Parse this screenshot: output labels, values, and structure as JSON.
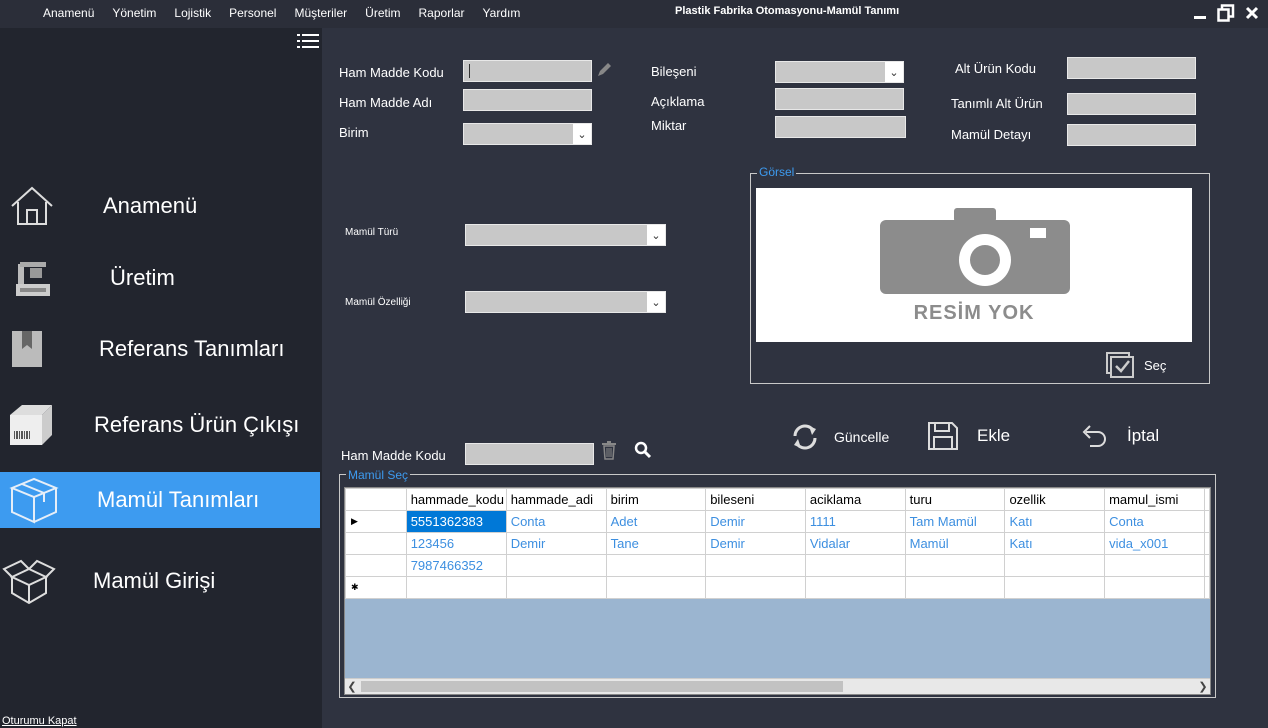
{
  "window": {
    "title": "Plastik Fabrika Otomasyonu-Mamül Tanımı",
    "menu": [
      "Anamenü",
      "Yönetim",
      "Lojistik",
      "Personel",
      "Müşteriler",
      "Üretim",
      "Raporlar",
      "Yardım"
    ]
  },
  "sidebar": {
    "items": [
      {
        "label": "Anamenü",
        "icon": "home-icon"
      },
      {
        "label": "Üretim",
        "icon": "machine-icon"
      },
      {
        "label": "Referans Tanımları",
        "icon": "bookmark-icon"
      },
      {
        "label": "Referans Ürün Çıkışı",
        "icon": "box-barcode-icon"
      },
      {
        "label": "Mamül Tanımları",
        "icon": "box-icon"
      },
      {
        "label": "Mamül Girişi",
        "icon": "open-box-icon"
      }
    ],
    "active_index": 4,
    "logout": "Oturumu Kapat"
  },
  "form": {
    "ham_madde_kodu": "Ham Madde Kodu",
    "ham_madde_adi": "Ham Madde Adı",
    "birim": "Birim",
    "bileseni": "Bileşeni",
    "aciklama": "Açıklama",
    "miktar": "Miktar",
    "alt_urun_kodu": "Alt Ürün Kodu",
    "tanimli_alt_urun": "Tanımlı Alt Ürün",
    "mamul_detayi": "Mamül Detayı",
    "mamul_turu": "Mamül Türü",
    "mamul_ozelligi": "Mamül Özelliği"
  },
  "gorsel": {
    "title": "Görsel",
    "no_image_text": "RESİM YOK",
    "select_label": "Seç"
  },
  "actions": {
    "guncelle": "Güncelle",
    "ekle": "Ekle",
    "iptal": "İptal"
  },
  "search": {
    "label": "Ham Madde Kodu"
  },
  "grid": {
    "title": "Mamül Seç",
    "columns": [
      "hammade_kodu",
      "hammade_adi",
      "birim",
      "bileseni",
      "aciklama",
      "turu",
      "ozellik",
      "mamul_ismi"
    ],
    "rows": [
      [
        "5551362383",
        "Conta",
        "Adet",
        "Demir",
        "1111",
        "Tam Mamül",
        "Katı",
        "Conta"
      ],
      [
        "123456",
        "Demir",
        "Tane",
        "Demir",
        "Vidalar",
        "Mamül",
        "Katı",
        "vida_x001"
      ],
      [
        "7987466352",
        "",
        "",
        "",
        "",
        "",
        "",
        ""
      ]
    ],
    "selected_row": 0
  },
  "colors": {
    "accent": "#3d9bf0",
    "sidebar_bg": "#22252e",
    "main_bg": "#2f3340",
    "grid_bg": "#9bb5d0"
  }
}
